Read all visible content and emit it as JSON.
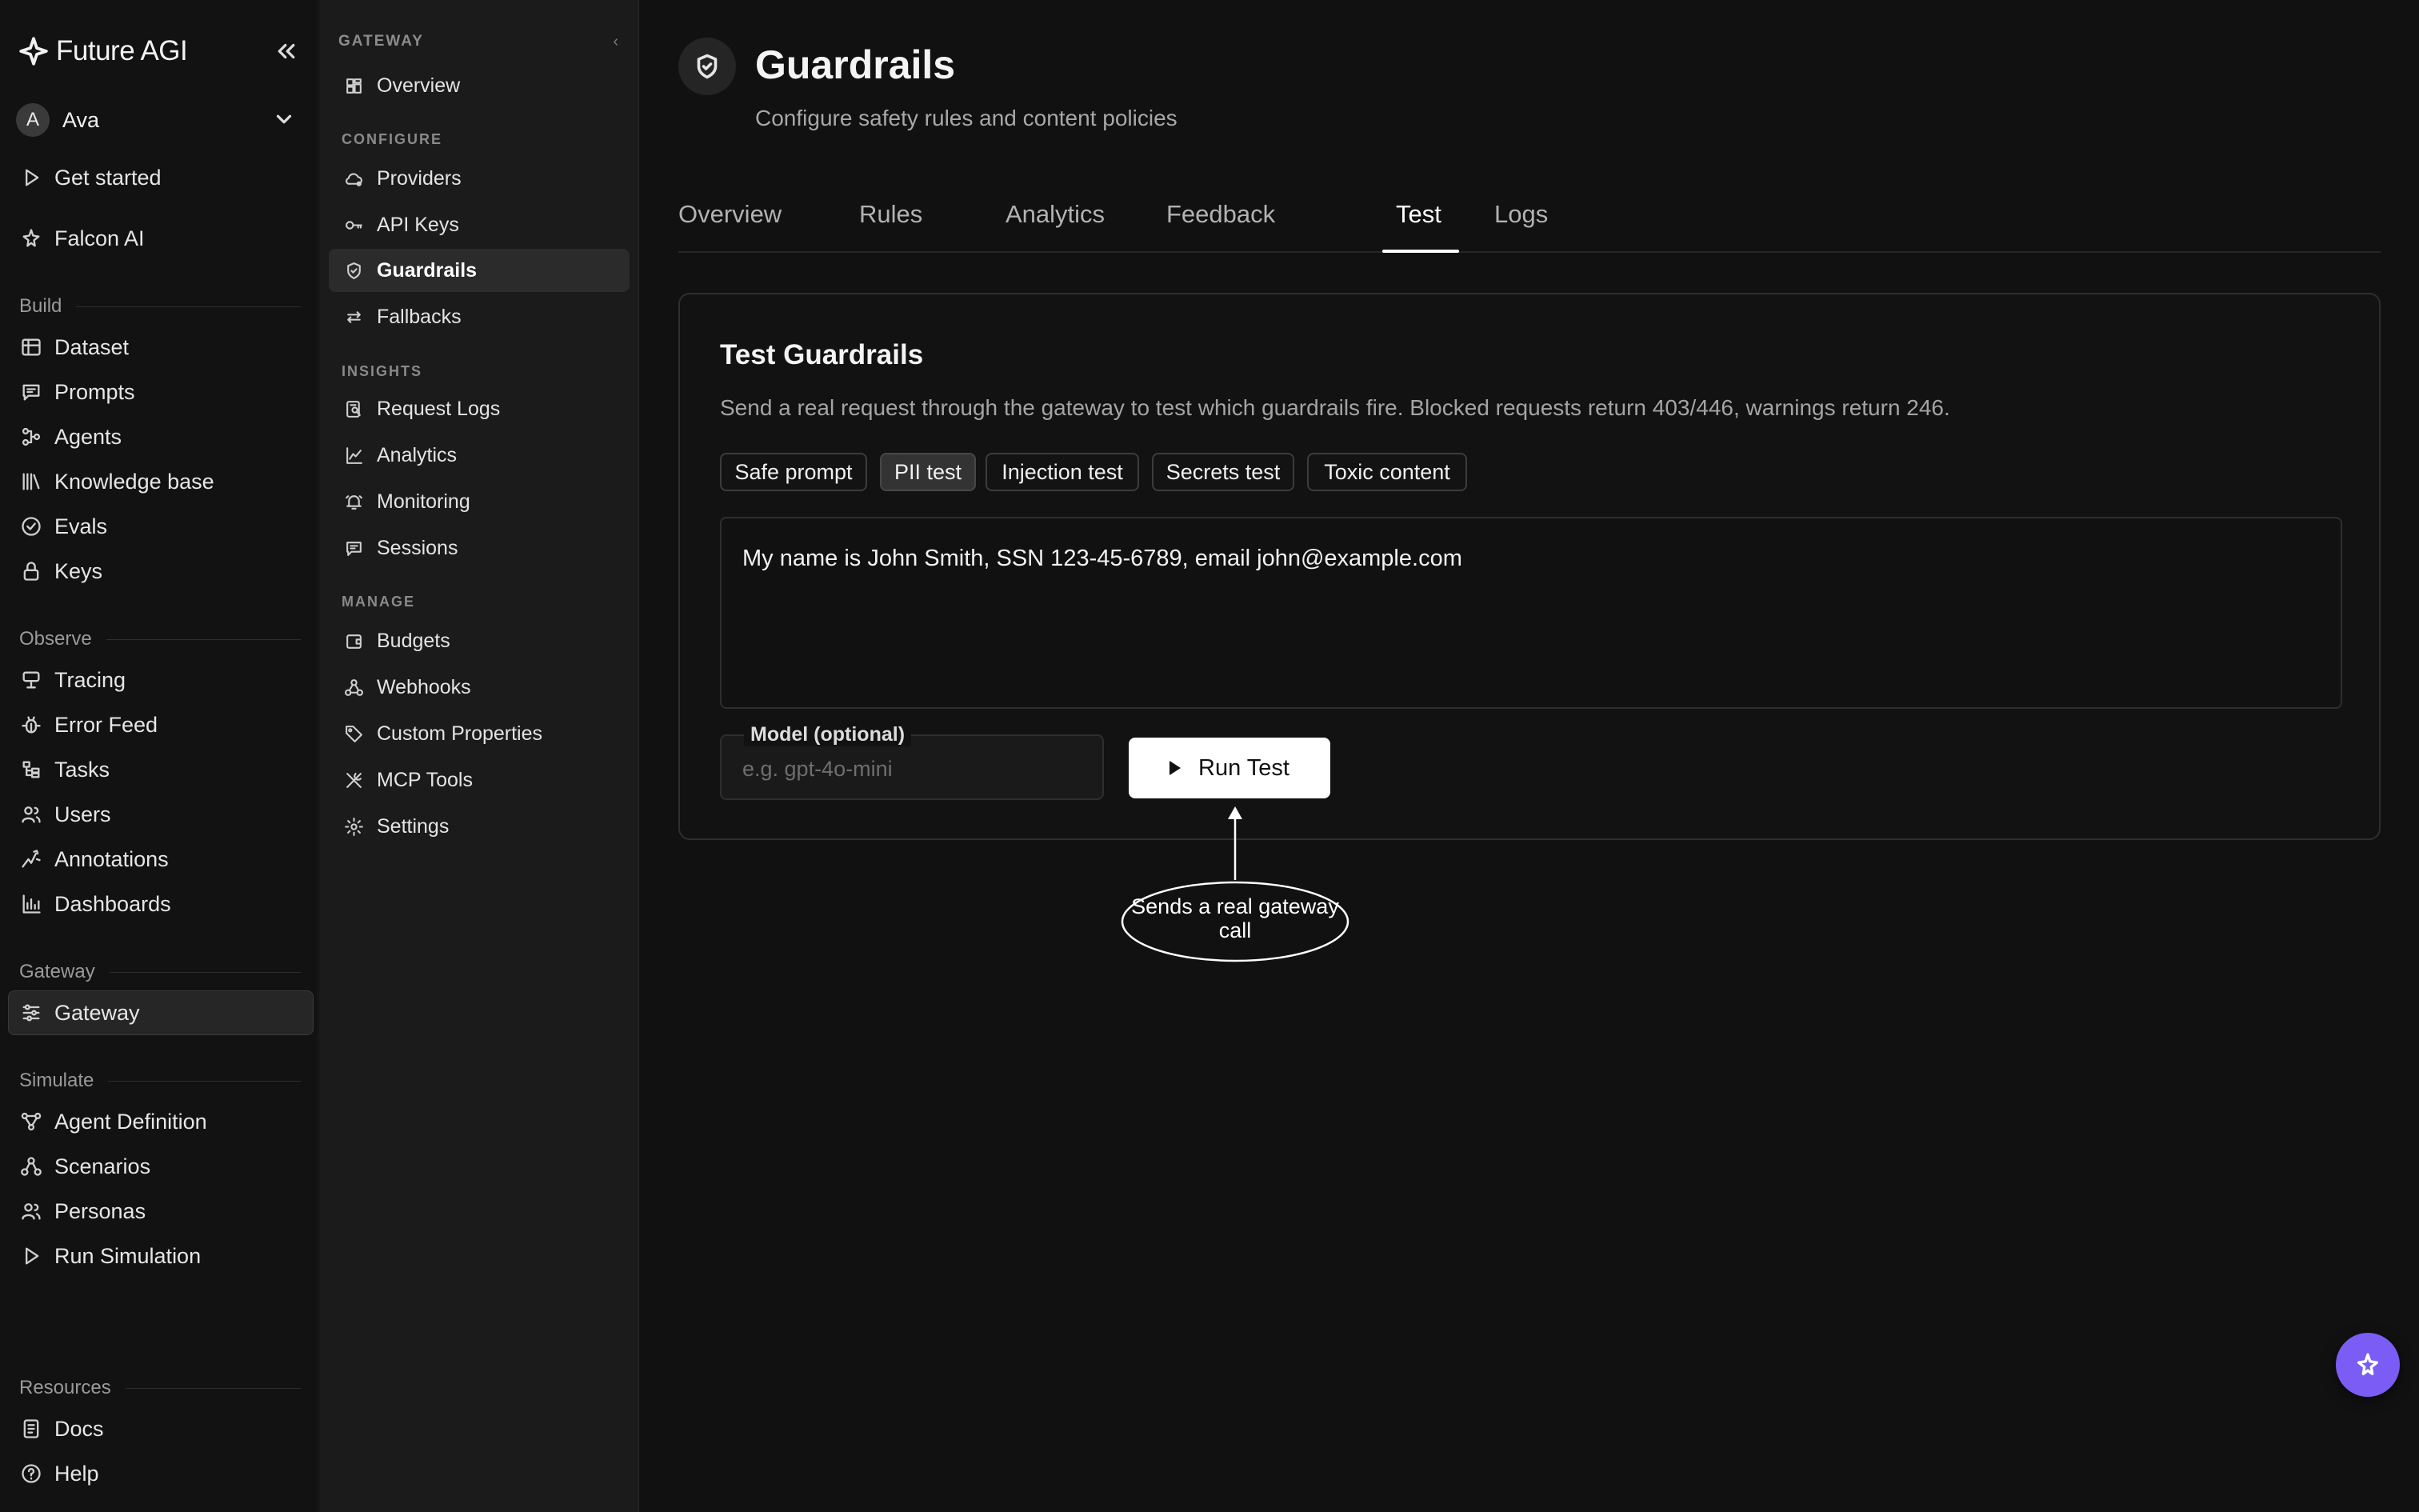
{
  "app": {
    "name": "Future AGI"
  },
  "user": {
    "initial": "A",
    "name": "Ava"
  },
  "primary_nav": {
    "top": [
      {
        "label": "Get started",
        "icon": "play-icon"
      },
      {
        "label": "Falcon AI",
        "icon": "falcon-icon"
      }
    ],
    "sections": {
      "build": "Build",
      "observe": "Observe",
      "gateway": "Gateway",
      "simulate": "Simulate",
      "resources": "Resources"
    },
    "build": [
      {
        "label": "Dataset",
        "icon": "table-icon"
      },
      {
        "label": "Prompts",
        "icon": "chat-icon"
      },
      {
        "label": "Agents",
        "icon": "agents-icon"
      },
      {
        "label": "Knowledge base",
        "icon": "library-icon"
      },
      {
        "label": "Evals",
        "icon": "check-circle-icon"
      },
      {
        "label": "Keys",
        "icon": "lock-icon"
      }
    ],
    "observe": [
      {
        "label": "Tracing",
        "icon": "tracing-icon"
      },
      {
        "label": "Error Feed",
        "icon": "bug-icon"
      },
      {
        "label": "Tasks",
        "icon": "tasks-icon"
      },
      {
        "label": "Users",
        "icon": "users-icon"
      },
      {
        "label": "Annotations",
        "icon": "annotation-icon"
      },
      {
        "label": "Dashboards",
        "icon": "bar-chart-icon"
      }
    ],
    "gateway": [
      {
        "label": "Gateway",
        "icon": "gateway-icon",
        "active": true
      }
    ],
    "simulate": [
      {
        "label": "Agent Definition",
        "icon": "graph-icon"
      },
      {
        "label": "Scenarios",
        "icon": "scenarios-icon"
      },
      {
        "label": "Personas",
        "icon": "users-icon"
      },
      {
        "label": "Run Simulation",
        "icon": "play-icon"
      }
    ],
    "resources": [
      {
        "label": "Docs",
        "icon": "docs-icon"
      },
      {
        "label": "Help",
        "icon": "help-icon"
      }
    ]
  },
  "gateway_nav": {
    "header": "GATEWAY",
    "overview": "Overview",
    "groups": {
      "configure": "CONFIGURE",
      "insights": "INSIGHTS",
      "manage": "MANAGE"
    },
    "configure": [
      "Providers",
      "API Keys",
      "Guardrails",
      "Fallbacks"
    ],
    "insights": [
      "Request Logs",
      "Analytics",
      "Monitoring",
      "Sessions"
    ],
    "manage": [
      "Budgets",
      "Webhooks",
      "Custom Properties",
      "MCP Tools",
      "Settings"
    ],
    "active": "Guardrails"
  },
  "page": {
    "title": "Guardrails",
    "subtitle": "Configure safety rules and content policies",
    "tabs": [
      "Overview",
      "Rules",
      "Analytics",
      "Feedback",
      "Test",
      "Logs"
    ],
    "active_tab": "Test"
  },
  "test_card": {
    "title": "Test Guardrails",
    "description": "Send a real request through the gateway to test which guardrails fire. Blocked requests return 403/446, warnings return 246.",
    "presets": [
      "Safe prompt",
      "PII test",
      "Injection test",
      "Secrets test",
      "Toxic content"
    ],
    "selected_preset": "PII test",
    "prompt": "My name is John Smith, SSN 123-45-6789, email john@example.com",
    "model_label": "Model (optional)",
    "model_placeholder": "e.g. gpt-4o-mini",
    "model_value": "",
    "run_label": "Run Test",
    "callout": "Sends a real gateway call"
  },
  "colors": {
    "accent": "#7b5cf4",
    "background": "#111111",
    "sidebar": "#1b1b1b"
  }
}
